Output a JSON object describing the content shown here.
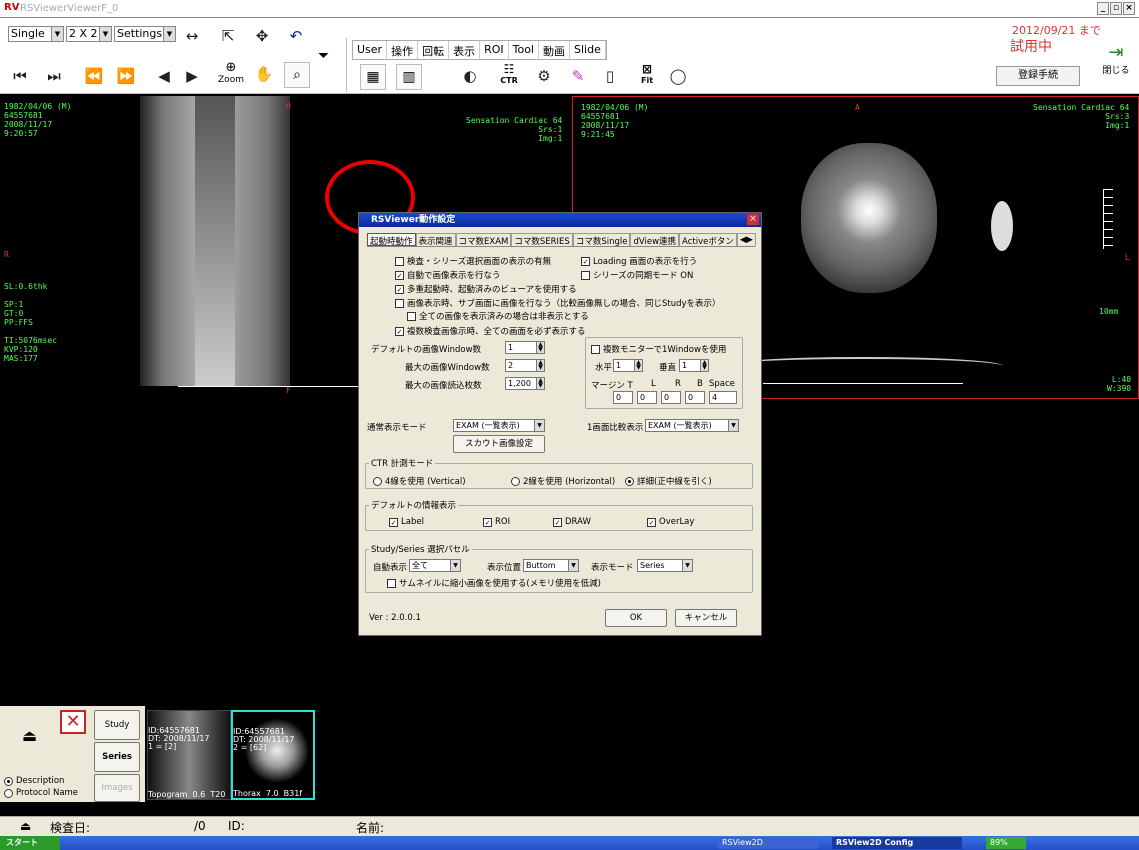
{
  "window": {
    "app_logo": "RV",
    "title": "RSViewerViewerF_0",
    "min": "_",
    "restore": "▫",
    "close": "×"
  },
  "toolbar": {
    "layout_select": "Single",
    "grid_select": "2 X 2",
    "settings_select": "Settings",
    "tabs": [
      "User",
      "操作",
      "回転",
      "表示",
      "ROI",
      "Tool",
      "動画",
      "Slide"
    ],
    "zoom_label": "Zoom",
    "trial_date": "2012/09/21 まで",
    "trial_label": "試用中",
    "register_button": "登録手続",
    "close_label": "閉じる",
    "ctr_label": "CTR",
    "fit_label": "Fit"
  },
  "left_view": {
    "top_left": "1982/04/06 (M)\n64557681\n2008/11/17\n9:20:57",
    "top_right": "Sensation Cardiac 64\nSrs:1\nImg:1",
    "mid_left": "SL:0.6thk\n\nSP:1\nGT:0\nPP:FFS\n\nTI:5076msec\nKVP:120\nMAS:177",
    "left_marker": "R",
    "top_marker": "H",
    "bottom_marker": "F"
  },
  "right_view": {
    "top_left": "1982/04/06 (M)\n64557681\n2008/11/17\n9:21:45",
    "top_right": "Sensation Cardiac 64\nSrs:3\nImg:1",
    "top_marker": "A",
    "right_marker": "L",
    "scale_label": "10mm",
    "wl": "L:40\nW:390"
  },
  "dialog": {
    "title": "RSViewer動作設定",
    "close": "×",
    "tabs": [
      "起動時動作",
      "表示関連",
      "コマ数EXAM",
      "コマ数SERIES",
      "コマ数Single",
      "dView連携",
      "Activeボタン"
    ],
    "opt_exam_select": "検査・シリーズ選択画面の表示の有無",
    "opt_loading": "Loading 画面の表示を行う",
    "opt_auto_display": "自動で画像表示を行なう",
    "opt_series_sync": "シリーズの同期モード ON",
    "opt_multi_launch": "多重起動時、起動済みのビューアを使用する",
    "opt_sub_screen": "画像表示時、サブ画面に画像を行なう（比較画像無しの場合、同じStudyを表示）",
    "opt_hide_all": "全ての画像を表示済みの場合は非表示とする",
    "opt_multi_exam": "複数検査画像示時、全ての画面を必ず表示する",
    "default_window_label": "デフォルトの画像Window数",
    "default_window_value": "1",
    "max_window_label": "最大の画像Window数",
    "max_window_value": "2",
    "max_read_label": "最大の画像読込枚数",
    "max_read_value": "1,200",
    "multi_monitor": "複数モニターで1Windowを使用",
    "horiz_label": "水平",
    "horiz_value": "1",
    "vert_label": "垂直",
    "vert_value": "1",
    "margin_label": "マージン T",
    "margin_l": "L",
    "margin_r": "R",
    "margin_b": "B",
    "margin_space": "Space",
    "margin_values": [
      "0",
      "0",
      "0",
      "0",
      "4"
    ],
    "normal_mode_label": "通常表示モード",
    "normal_mode_value": "EXAM (一覧表示)",
    "compare_label": "1画面比較表示",
    "compare_value": "EXAM (一覧表示)",
    "scout_button": "スカウト画像設定",
    "ctr_group": "CTR 計測モード",
    "ctr_opt1": "4線を使用 (Vertical)",
    "ctr_opt2": "2線を使用 (Horizontal)",
    "ctr_opt3": "詳細(正中線を引く)",
    "info_group": "デフォルトの情報表示",
    "info_label": "Label",
    "info_roi": "ROI",
    "info_draw": "DRAW",
    "info_overlay": "OverLay",
    "study_group": "Study/Series 選択パセル",
    "auto_label": "自動表示",
    "auto_value": "全て",
    "pos_label": "表示位置",
    "pos_value": "Buttom",
    "mode_label": "表示モード",
    "mode_value": "Series",
    "thumb_opt": "サムネイルに縮小画像を使用する(メモリ使用を低減)",
    "version": "Ver : 2.0.0.1",
    "ok": "OK",
    "cancel": "キャンセル"
  },
  "bottom": {
    "study": "Study",
    "series": "Series",
    "images": "Images",
    "radio_desc": "Description",
    "radio_proto": "Protocol Name",
    "thumb1_top": "ID:64557681\nDT: 2008/11/17\n1 = [2]",
    "thumb1_bottom": "Topogram  0.6  T20",
    "thumb2_top": "ID:64557681\nDT: 2008/11/17\n2 = [62]",
    "thumb2_bottom": "Thorax  7.0  B31f"
  },
  "status": {
    "exam_date": "検査日:",
    "slash": "/0",
    "id": "ID:",
    "name": "名前:"
  },
  "taskbar": {
    "start": "スタート",
    "app1": "RSView2D",
    "app2": "RSView2D Config",
    "battery": "89%"
  }
}
